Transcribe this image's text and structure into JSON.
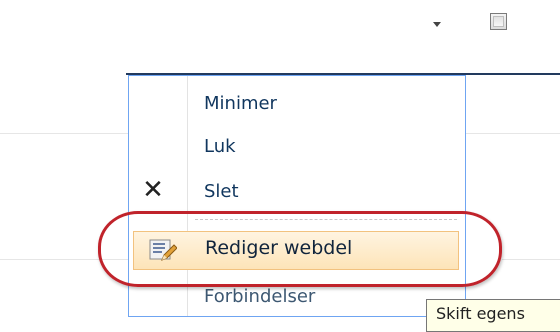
{
  "toolbar": {
    "dropdown_icon": "dropdown-arrow-icon",
    "checkbox_icon": "checkbox-icon",
    "checkbox_checked": false
  },
  "menu": {
    "items": [
      {
        "label": "Minimer",
        "icon": null
      },
      {
        "label": "Luk",
        "icon": null
      },
      {
        "label": "Slet",
        "icon": "delete-x-icon"
      },
      {
        "label": "Rediger webdel",
        "icon": "edit-webpart-icon",
        "highlighted": true
      },
      {
        "label": "Forbindelser",
        "icon": null
      }
    ]
  },
  "tooltip": {
    "text": "Skift egens"
  },
  "colors": {
    "header_rule": "#223a5e",
    "menu_border": "#6fa5f2",
    "highlight_border": "#f2c27f",
    "annotation": "#c0232b"
  }
}
